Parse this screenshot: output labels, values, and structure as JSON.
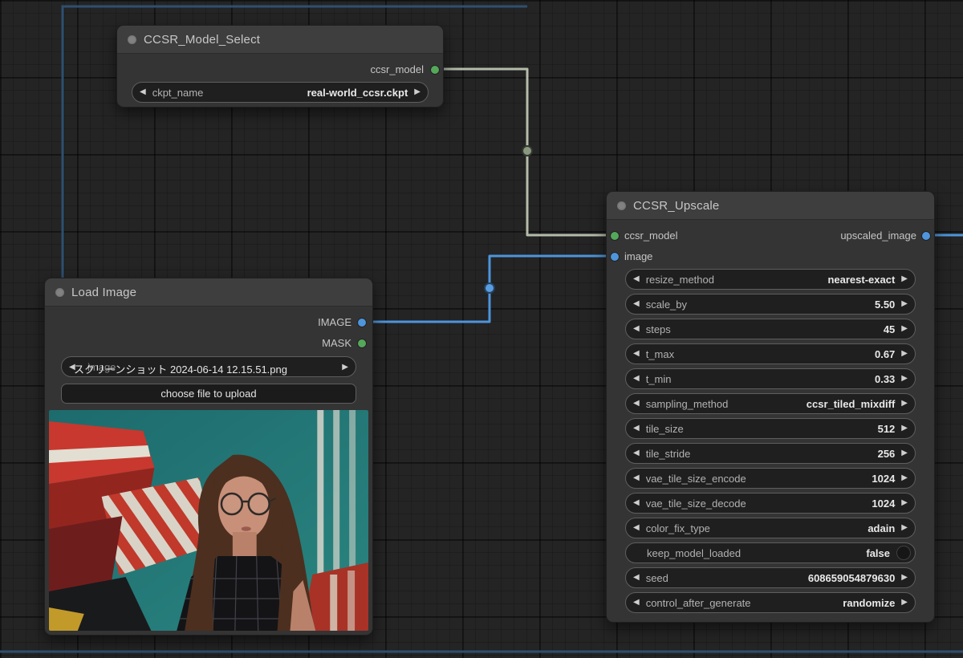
{
  "icons": {
    "left_arrow": "◀",
    "right_arrow": "▶"
  },
  "colors": {
    "canvas_bg": "#242424",
    "node_bg": "#343434",
    "node_title_bg": "#3e3e3e",
    "widget_bg": "#1f1f1f",
    "slot_green": "#55a85a",
    "slot_blue": "#4e95dc",
    "link_model": "#b4bcab",
    "link_image": "#4e95dc",
    "link_background": "#2e4f70"
  },
  "nodes": {
    "model_select": {
      "title": "CCSR_Model_Select",
      "outputs": [
        {
          "name": "ccsr_model"
        }
      ],
      "widgets": [
        {
          "label": "ckpt_name",
          "value": "real-world_ccsr.ckpt"
        }
      ]
    },
    "load_image": {
      "title": "Load Image",
      "outputs": [
        {
          "name": "IMAGE"
        },
        {
          "name": "MASK"
        }
      ],
      "widgets": {
        "image_combo": {
          "label": "image",
          "value": "スクリーンショット 2024-06-14 12.15.51.png"
        },
        "upload_button": "choose file to upload"
      }
    },
    "upscale": {
      "title": "CCSR_Upscale",
      "inputs": [
        {
          "name": "ccsr_model"
        },
        {
          "name": "image"
        }
      ],
      "outputs": [
        {
          "name": "upscaled_image"
        }
      ],
      "widgets": [
        {
          "label": "resize_method",
          "value": "nearest-exact"
        },
        {
          "label": "scale_by",
          "value": "5.50"
        },
        {
          "label": "steps",
          "value": "45"
        },
        {
          "label": "t_max",
          "value": "0.67"
        },
        {
          "label": "t_min",
          "value": "0.33"
        },
        {
          "label": "sampling_method",
          "value": "ccsr_tiled_mixdiff"
        },
        {
          "label": "tile_size",
          "value": "512"
        },
        {
          "label": "tile_stride",
          "value": "256"
        },
        {
          "label": "vae_tile_size_encode",
          "value": "1024"
        },
        {
          "label": "vae_tile_size_decode",
          "value": "1024"
        },
        {
          "label": "color_fix_type",
          "value": "adain"
        },
        {
          "label": "keep_model_loaded",
          "value": "false"
        },
        {
          "label": "seed",
          "value": "608659054879630"
        },
        {
          "label": "control_after_generate",
          "value": "randomize"
        }
      ]
    }
  }
}
